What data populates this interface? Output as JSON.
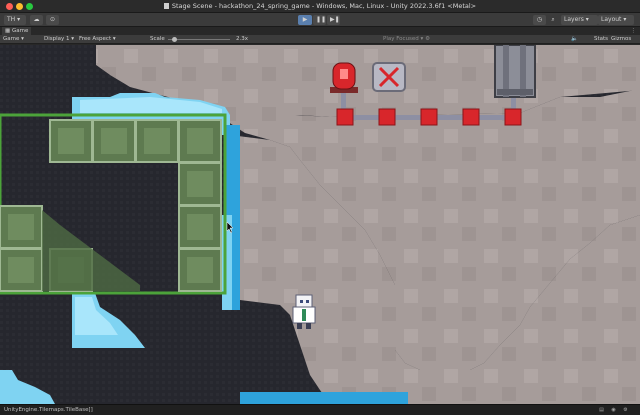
{
  "window": {
    "title": "Stage Scene - hackathon_24_spring_game - Windows, Mac, Linux - Unity 2022.3.6f1 <Metal>"
  },
  "toolbar": {
    "account_label": "TH",
    "layers_label": "Layers",
    "layout_label": "Layout"
  },
  "tab": {
    "game_label": "Game"
  },
  "gamebar": {
    "game_select": "Game",
    "display_select": "Display 1",
    "aspect_select": "Free Aspect",
    "scale_label": "Scale",
    "scale_value": "2.3x",
    "play_focused": "Play Focused",
    "stats_label": "Stats",
    "gizmos_label": "Gizmos"
  },
  "status": {
    "message": "UnityEngine.Tilemaps.TileBase[]"
  },
  "colors": {
    "stone": "#a89e9c",
    "dark": "#26272e",
    "water": "#7fd3f2",
    "water_deep": "#2ea3dc",
    "green_block": "#5e7a50",
    "red_button": "#d8262b",
    "pipe": "#8d8fa3"
  }
}
